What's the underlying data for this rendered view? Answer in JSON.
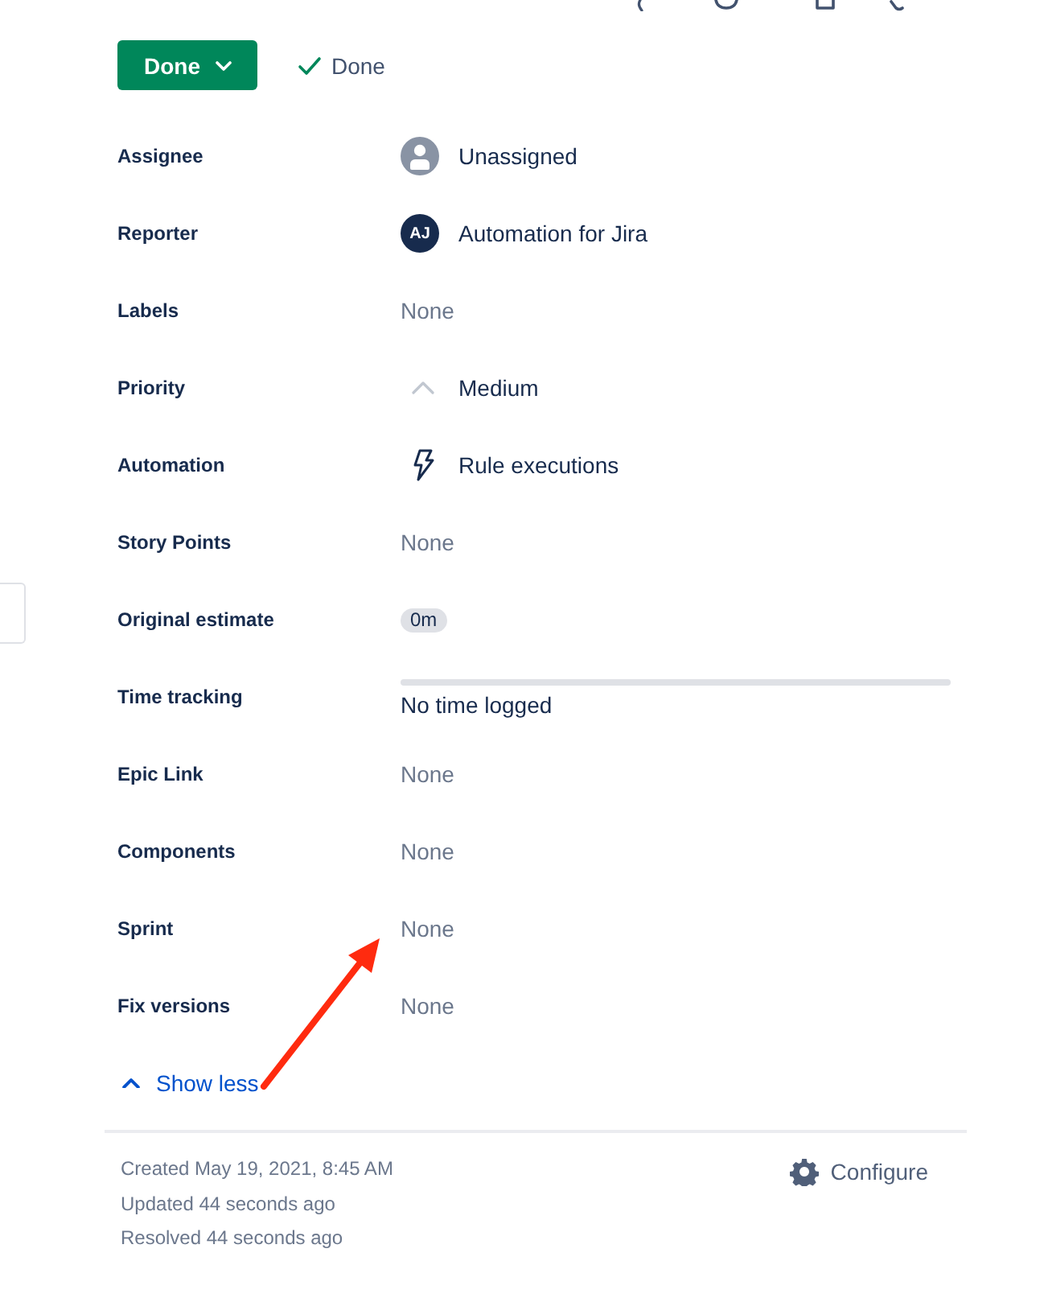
{
  "status": {
    "button": "Done",
    "resolution": "Done"
  },
  "fields": [
    {
      "label": "Assignee",
      "kind": "unassigned",
      "value": "Unassigned"
    },
    {
      "label": "Reporter",
      "kind": "user",
      "initials": "AJ",
      "value": "Automation for Jira"
    },
    {
      "label": "Labels",
      "kind": "empty",
      "value": "None"
    },
    {
      "label": "Priority",
      "kind": "priority",
      "value": "Medium"
    },
    {
      "label": "Automation",
      "kind": "automation",
      "value": "Rule executions"
    },
    {
      "label": "Story Points",
      "kind": "empty",
      "value": "None"
    },
    {
      "label": "Original estimate",
      "kind": "estimate",
      "value": "0m"
    },
    {
      "label": "Time tracking",
      "kind": "progress",
      "level": 0,
      "value": "No time logged"
    },
    {
      "label": "Epic Link",
      "kind": "empty",
      "value": "None"
    },
    {
      "label": "Components",
      "kind": "empty",
      "value": "None"
    },
    {
      "label": "Sprint",
      "kind": "empty",
      "value": "None"
    },
    {
      "label": "Fix versions",
      "kind": "empty",
      "value": "None"
    }
  ],
  "toggle": {
    "label": "Show less",
    "expanded": true
  },
  "footer": {
    "dates": [
      "Created May 19, 2021, 8:45 AM",
      "Updated 44 seconds ago",
      "Resolved 44 seconds ago"
    ],
    "configure": "Configure"
  }
}
